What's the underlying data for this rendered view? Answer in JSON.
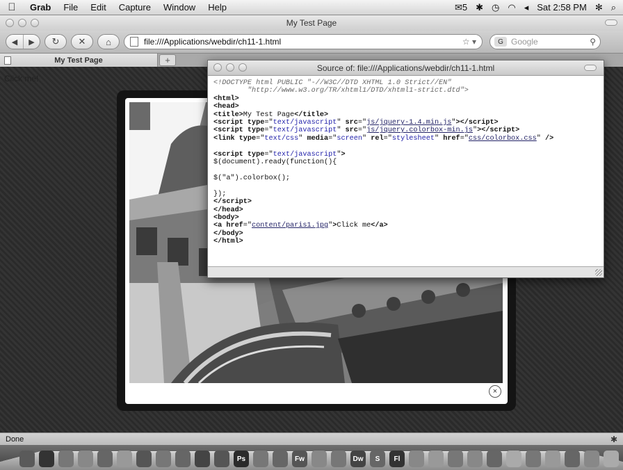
{
  "menubar": {
    "apple": "",
    "items": [
      "Grab",
      "File",
      "Edit",
      "Capture",
      "Window",
      "Help"
    ],
    "right": {
      "mail_count": "5",
      "clock": "Sat 2:58 PM"
    }
  },
  "window": {
    "title": "My Test Page"
  },
  "toolbar": {
    "back": "◀",
    "forward": "▶",
    "reload": "↻",
    "stop": "✕",
    "home": "⌂",
    "url": "file:///Applications/webdir/ch11-1.html",
    "bookmark_star": "☆ ▾",
    "search_placeholder": "Google",
    "search_engine": "G"
  },
  "tabs": {
    "active": "My Test Page",
    "new_tab": "+"
  },
  "page": {
    "link_text": "Click me!",
    "close_symbol": "×"
  },
  "source_window": {
    "title": "Source of: file:///Applications/webdir/ch11-1.html"
  },
  "statusbar": {
    "text": "Done"
  },
  "dock": {
    "labels": [
      "Ps",
      "Fw",
      "Dw",
      "S",
      "Fl"
    ]
  }
}
